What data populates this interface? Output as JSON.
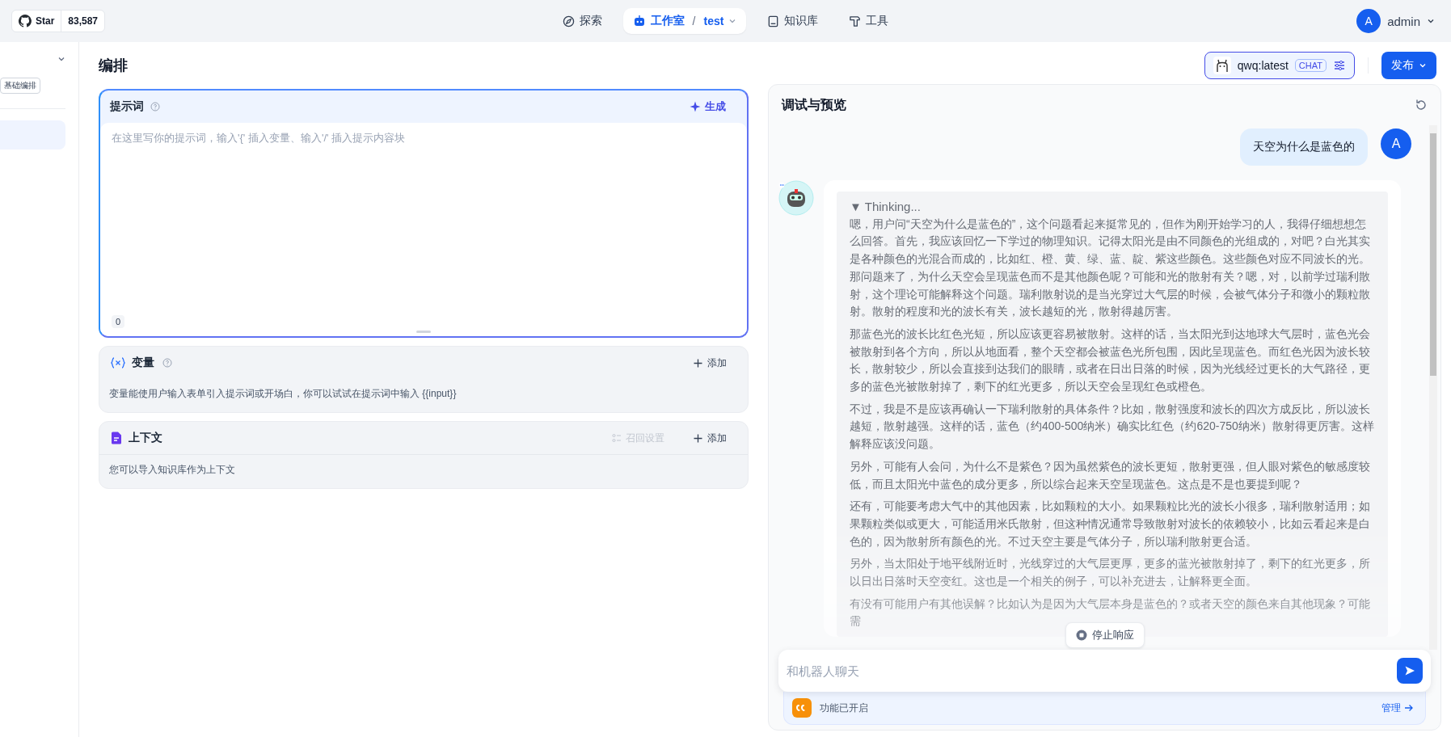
{
  "github": {
    "label": "Star",
    "count": "83,587"
  },
  "nav": [
    {
      "kind": "explore",
      "label": "探索",
      "selected": false
    },
    {
      "kind": "studio",
      "label": "工作室",
      "separator": "/",
      "sub": "test",
      "selected": true
    },
    {
      "kind": "knowledge",
      "label": "知识库",
      "selected": false
    },
    {
      "kind": "tools",
      "label": "工具",
      "selected": false
    }
  ],
  "user": {
    "avatar": "A",
    "name": "admin"
  },
  "sidebar": {
    "mode_tag": "基础编排",
    "items": [
      {
        "selected": true
      }
    ]
  },
  "editor": {
    "title": "编排",
    "prompt": {
      "title": "提示词",
      "generate": "生成",
      "placeholder": "在这里写你的提示词，输入'{' 插入变量、输入'/' 插入提示内容块",
      "count": "0"
    },
    "variables": {
      "title": "变量",
      "add": "添加",
      "description": "变量能使用户输入表单引入提示词或开场白，你可以试试在提示词中输入 {{input}}"
    },
    "context": {
      "title": "上下文",
      "settings": {
        "label": "召回设置",
        "disabled": true
      },
      "add": "添加",
      "description": "您可以导入知识库作为上下文"
    }
  },
  "model": {
    "name": "qwq:latest",
    "tag": "CHAT"
  },
  "publish": "发布",
  "preview": {
    "title": "调试与预览",
    "messages": [
      {
        "kind": "user",
        "avatar": "A",
        "text": "天空为什么是蓝色的"
      },
      {
        "kind": "bot",
        "thinking_label": "▼ Thinking...",
        "paragraphs": [
          [
            "嗯，用户问“天空为什么是蓝色的”，这个问题看起来挺常见的，但作为刚开始学习的人，我得仔细想想怎么回答。首先，我应该回忆一下学过的物理知识。记得太阳光是由不同颜色的光组成的，对吧？白光其实是各种颜色的光混合而成的，比如红、橙、黄、绿、蓝、靛、紫这些颜色。这些颜色对应不同波长的光。",
            "那问题来了，为什么天空会呈现蓝色而不是其他颜色呢？可能和光的散射有关？嗯，对，以前学过瑞利散射，这个理论可能解释这个问题。瑞利散射说的是当光穿过大气层的时候，会被气体分子和微小的颗粒散射。散射的程度和光的波长有关，波长越短的光，散射得越厉害。"
          ],
          [
            "那蓝色光的波长比红色光短，所以应该更容易被散射。这样的话，当太阳光到达地球大气层时，蓝色光会被散射到各个方向，所以从地面看，整个天空都会被蓝色光所包围，因此呈现蓝色。而红色光因为波长较长，散射较少，所以会直接到达我们的眼睛，或者在日出日落的时候，因为光线经过更长的大气路径，更多的蓝色光被散射掉了，剩下的红光更多，所以天空会呈现红色或橙色。"
          ],
          [
            "不过，我是不是应该再确认一下瑞利散射的具体条件？比如，散射强度和波长的四次方成反比，所以波长越短，散射越强。这样的话，蓝色（约400-500纳米）确实比红色（约620-750纳米）散射得更厉害。这样解释应该没问题。"
          ],
          [
            "另外，可能有人会问，为什么不是紫色？因为虽然紫色的波长更短，散射更强，但人眼对紫色的敏感度较低，而且太阳光中蓝色的成分更多，所以综合起来天空呈现蓝色。这点是不是也要提到呢？"
          ],
          [
            "还有，可能要考虑大气中的其他因素，比如颗粒的大小。如果颗粒比光的波长小很多，瑞利散射适用；如果颗粒类似或更大，可能适用米氏散射，但这种情况通常导致散射对波长的依赖较小，比如云看起来是白色的，因为散射所有颜色的光。不过天空主要是气体分子，所以瑞利散射更合适。"
          ],
          [
            "另外，当太阳处于地平线附近时，光线穿过的大气层更厚，更多的蓝光被散射掉了，剩下的红光更多，所以日出日落时天空变红。这也是一个相关的例子，可以补充进去，让解释更全面。"
          ],
          [
            "有没有可能用户有其他误解？比如认为是因为大气层本身是蓝色的？或者天空的颜色来自其他现象？可能需"
          ]
        ]
      }
    ],
    "stop": "停止响应",
    "input": {
      "placeholder": "和机器人聊天"
    },
    "features": {
      "label": "功能已开启",
      "manage": "管理"
    }
  }
}
